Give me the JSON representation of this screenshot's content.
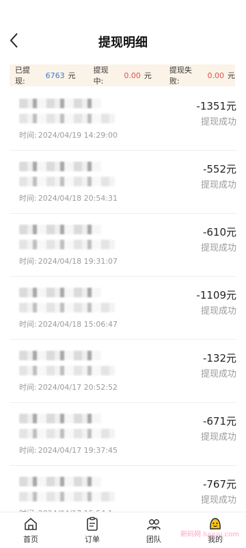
{
  "header": {
    "title": "提现明细"
  },
  "summary": {
    "withdrawn_label": "已提现:",
    "withdrawn_value": "6763",
    "processing_label": "提现中:",
    "processing_value": "0.00",
    "failed_label": "提现失败:",
    "failed_value": "0.00",
    "unit": "元"
  },
  "records": [
    {
      "time_label": "时间:",
      "time": "2024/04/19 14:29:00",
      "amount": "-1351元",
      "status": "提现成功"
    },
    {
      "time_label": "时间:",
      "time": "2024/04/18 20:54:31",
      "amount": "-552元",
      "status": "提现成功"
    },
    {
      "time_label": "时间:",
      "time": "2024/04/18 19:31:07",
      "amount": "-610元",
      "status": "提现成功"
    },
    {
      "time_label": "时间:",
      "time": "2024/04/18 15:06:47",
      "amount": "-1109元",
      "status": "提现成功"
    },
    {
      "time_label": "时间:",
      "time": "2024/04/17 20:52:52",
      "amount": "-132元",
      "status": "提现成功"
    },
    {
      "time_label": "时间:",
      "time": "2024/04/17 19:37:45",
      "amount": "-671元",
      "status": "提现成功"
    },
    {
      "time_label": "时间:",
      "time": "2024/04/17 15:54:1",
      "amount": "-767元",
      "status": "提现成功"
    }
  ],
  "tabbar": {
    "tabs": [
      {
        "label": "首页",
        "icon": "home-icon"
      },
      {
        "label": "订单",
        "icon": "order-icon"
      },
      {
        "label": "团队",
        "icon": "team-icon"
      },
      {
        "label": "我的",
        "icon": "profile-icon"
      }
    ],
    "active_color": "#f5c518"
  },
  "watermark": "新码网 luuuu.com"
}
